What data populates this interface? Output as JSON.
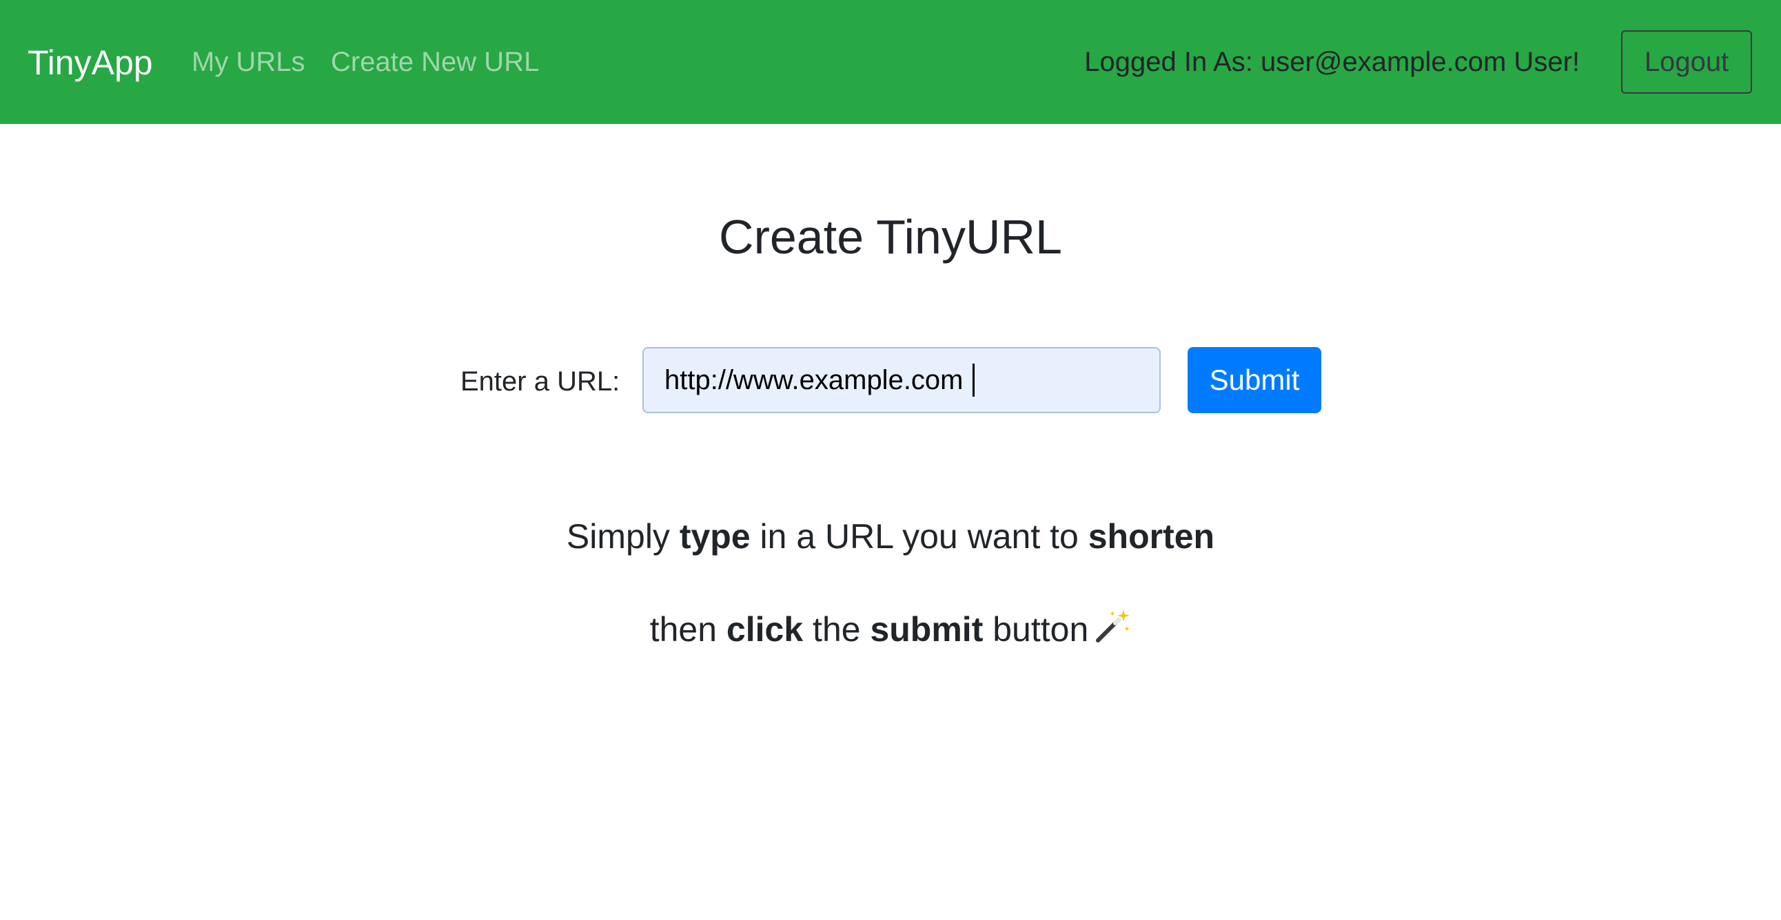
{
  "navbar": {
    "brand": "TinyApp",
    "links": [
      "My URLs",
      "Create New URL"
    ],
    "logged_in_text": "Logged In As: user@example.com User!",
    "logout_label": "Logout",
    "background_color": "#28a745"
  },
  "main": {
    "title": "Create TinyURL",
    "form": {
      "label": "Enter a URL:",
      "input_value": "http://www.example.com",
      "submit_label": "Submit",
      "submit_color": "#007bff"
    },
    "instructions": {
      "line1": {
        "pre": "Simply ",
        "bold1": "type",
        "mid": " in a URL you want to ",
        "bold2": "shorten"
      },
      "line2": {
        "pre": "then ",
        "bold1": "click",
        "mid": " the ",
        "bold2": "submit",
        "post": " button",
        "icon": "magic-wand-icon"
      }
    }
  }
}
